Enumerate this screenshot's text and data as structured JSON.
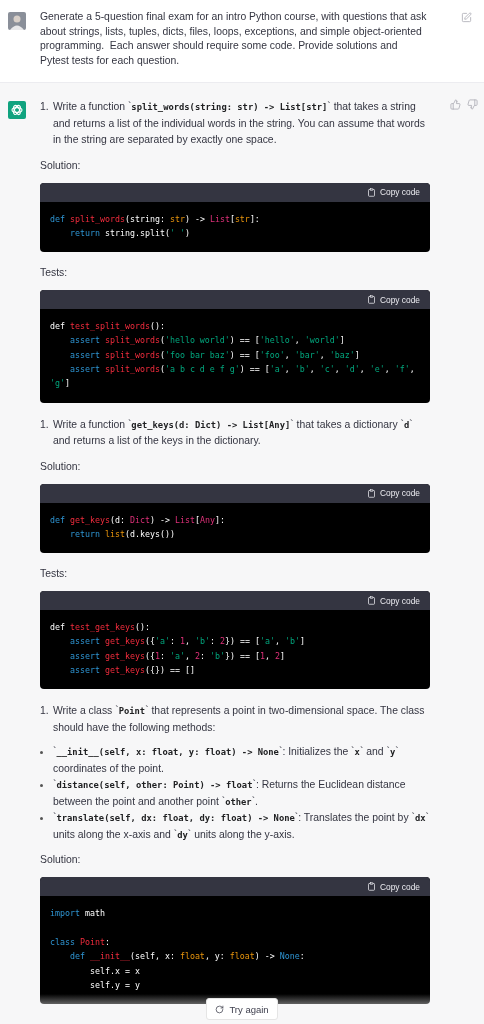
{
  "user_message": {
    "text": "Generate a 5-question final exam for an intro Python course, with questions that ask about strings, lists, tuples, dicts, files, loops, exceptions, and simple object-oriented programming.  Each answer should require some code. Provide solutions and Pytest tests for each question."
  },
  "assistant_message": {
    "blocks": [
      {
        "kind": "item",
        "number": "1.",
        "text": "Write a function `**split_words(string: str) -> List[str]**` that takes a string and returns a list of the individual words in the string. You can assume that words in the string are separated by exactly one space."
      },
      {
        "kind": "label",
        "text": "Solution:"
      },
      {
        "kind": "code",
        "copy_label": "Copy code",
        "groups": [
          [
            [
              {
                "kind": "keyword",
                "text": "def "
              },
              {
                "kind": "function",
                "text": "split_words"
              },
              {
                "kind": "plain",
                "text": "(string: "
              },
              {
                "kind": "builtin",
                "text": "str"
              },
              {
                "kind": "plain",
                "text": ") -> "
              },
              {
                "kind": "type",
                "text": "List"
              },
              {
                "kind": "plain",
                "text": "["
              },
              {
                "kind": "builtin",
                "text": "str"
              },
              {
                "kind": "plain",
                "text": "]:"
              }
            ],
            [
              {
                "kind": "keyword",
                "text": "    return"
              },
              {
                "kind": "plain",
                "text": " string.split("
              },
              {
                "kind": "string",
                "text": "' '"
              },
              {
                "kind": "plain",
                "text": ")"
              }
            ]
          ]
        ]
      },
      {
        "kind": "label",
        "text": "Tests:"
      },
      {
        "kind": "code",
        "copy_label": "Copy code",
        "groups": [
          [
            [
              {
                "kind": "plain",
                "text": "def "
              },
              {
                "kind": "function",
                "text": "test_split_words"
              },
              {
                "kind": "plain",
                "text": "():"
              }
            ],
            [
              {
                "kind": "keyword",
                "text": "    assert "
              },
              {
                "kind": "function",
                "text": "split_words"
              },
              {
                "kind": "plain",
                "text": "("
              },
              {
                "kind": "string",
                "text": "'hello world'"
              },
              {
                "kind": "plain",
                "text": ") == ["
              },
              {
                "kind": "string",
                "text": "'hello'"
              },
              {
                "kind": "plain",
                "text": ", "
              },
              {
                "kind": "string",
                "text": "'world'"
              },
              {
                "kind": "plain",
                "text": "]"
              }
            ],
            [
              {
                "kind": "keyword",
                "text": "    assert "
              },
              {
                "kind": "function",
                "text": "split_words"
              },
              {
                "kind": "plain",
                "text": "("
              },
              {
                "kind": "string",
                "text": "'foo bar baz'"
              },
              {
                "kind": "plain",
                "text": ") == ["
              },
              {
                "kind": "string",
                "text": "'foo'"
              },
              {
                "kind": "plain",
                "text": ", "
              },
              {
                "kind": "string",
                "text": "'bar'"
              },
              {
                "kind": "plain",
                "text": ", "
              },
              {
                "kind": "string",
                "text": "'baz'"
              },
              {
                "kind": "plain",
                "text": "]"
              }
            ],
            [
              {
                "kind": "keyword",
                "text": "    assert "
              },
              {
                "kind": "function",
                "text": "split_words"
              },
              {
                "kind": "plain",
                "text": "("
              },
              {
                "kind": "string",
                "text": "'a b c d e f g'"
              },
              {
                "kind": "plain",
                "text": ") == ["
              },
              {
                "kind": "string",
                "text": "'a'"
              },
              {
                "kind": "plain",
                "text": ", "
              },
              {
                "kind": "string",
                "text": "'b'"
              },
              {
                "kind": "plain",
                "text": ", "
              },
              {
                "kind": "string",
                "text": "'c'"
              },
              {
                "kind": "plain",
                "text": ", "
              },
              {
                "kind": "string",
                "text": "'d'"
              },
              {
                "kind": "plain",
                "text": ", "
              },
              {
                "kind": "string",
                "text": "'e'"
              },
              {
                "kind": "plain",
                "text": ", "
              },
              {
                "kind": "string",
                "text": "'f'"
              },
              {
                "kind": "plain",
                "text": ","
              }
            ],
            [
              {
                "kind": "string",
                "text": "'g'"
              },
              {
                "kind": "plain",
                "text": "]"
              }
            ]
          ]
        ]
      },
      {
        "kind": "item",
        "number": "1.",
        "text": "Write a function `**get_keys(d: Dict) -> List[Any]**` that takes a dictionary `**d**` and returns a list of the keys in the dictionary."
      },
      {
        "kind": "label",
        "text": "Solution:"
      },
      {
        "kind": "code",
        "copy_label": "Copy code",
        "groups": [
          [
            [
              {
                "kind": "keyword",
                "text": "def "
              },
              {
                "kind": "function",
                "text": "get_keys"
              },
              {
                "kind": "plain",
                "text": "(d: "
              },
              {
                "kind": "type",
                "text": "Dict"
              },
              {
                "kind": "plain",
                "text": ") -> "
              },
              {
                "kind": "type",
                "text": "List"
              },
              {
                "kind": "plain",
                "text": "["
              },
              {
                "kind": "type",
                "text": "Any"
              },
              {
                "kind": "plain",
                "text": "]:"
              }
            ],
            [
              {
                "kind": "keyword",
                "text": "    return "
              },
              {
                "kind": "builtin",
                "text": "list"
              },
              {
                "kind": "plain",
                "text": "(d.keys())"
              }
            ]
          ]
        ]
      },
      {
        "kind": "label",
        "text": "Tests:"
      },
      {
        "kind": "code",
        "copy_label": "Copy code",
        "groups": [
          [
            [
              {
                "kind": "plain",
                "text": "def "
              },
              {
                "kind": "function",
                "text": "test_get_keys"
              },
              {
                "kind": "plain",
                "text": "():"
              }
            ],
            [
              {
                "kind": "keyword",
                "text": "    assert "
              },
              {
                "kind": "function",
                "text": "get_keys"
              },
              {
                "kind": "plain",
                "text": "({"
              },
              {
                "kind": "string",
                "text": "'a'"
              },
              {
                "kind": "plain",
                "text": ": "
              },
              {
                "kind": "number",
                "text": "1"
              },
              {
                "kind": "plain",
                "text": ", "
              },
              {
                "kind": "string",
                "text": "'b'"
              },
              {
                "kind": "plain",
                "text": ": "
              },
              {
                "kind": "number",
                "text": "2"
              },
              {
                "kind": "plain",
                "text": "}) == ["
              },
              {
                "kind": "string",
                "text": "'a'"
              },
              {
                "kind": "plain",
                "text": ", "
              },
              {
                "kind": "string",
                "text": "'b'"
              },
              {
                "kind": "plain",
                "text": "]"
              }
            ],
            [
              {
                "kind": "keyword",
                "text": "    assert "
              },
              {
                "kind": "function",
                "text": "get_keys"
              },
              {
                "kind": "plain",
                "text": "({"
              },
              {
                "kind": "number",
                "text": "1"
              },
              {
                "kind": "plain",
                "text": ": "
              },
              {
                "kind": "string",
                "text": "'a'"
              },
              {
                "kind": "plain",
                "text": ", "
              },
              {
                "kind": "number",
                "text": "2"
              },
              {
                "kind": "plain",
                "text": ": "
              },
              {
                "kind": "string",
                "text": "'b'"
              },
              {
                "kind": "plain",
                "text": "}) == ["
              },
              {
                "kind": "number",
                "text": "1"
              },
              {
                "kind": "plain",
                "text": ", "
              },
              {
                "kind": "number",
                "text": "2"
              },
              {
                "kind": "plain",
                "text": "]"
              }
            ],
            [
              {
                "kind": "keyword",
                "text": "    assert "
              },
              {
                "kind": "function",
                "text": "get_keys"
              },
              {
                "kind": "plain",
                "text": "({}) == []"
              }
            ]
          ]
        ]
      },
      {
        "kind": "item",
        "number": "1.",
        "text": "Write a class `**Point**` that represents a point in two-dimensional space. The class should have the following methods:",
        "bullets": [
          "`**__init__(self, x: float, y: float) -> None**`: Initializes the `**x**` and `**y**` coordinates of the point.",
          "`**distance(self, other: Point) -> float**`: Returns the Euclidean distance between the point and another point `**other**`.",
          "`**translate(self, dx: float, dy: float) -> None**`: Translates the point by `**dx**` units along the x-axis and `**dy**` units along the y-axis."
        ]
      },
      {
        "kind": "label",
        "text": "Solution:"
      },
      {
        "kind": "code",
        "copy_label": "Copy code",
        "groups": [
          [
            [
              {
                "kind": "keyword",
                "text": "import"
              },
              {
                "kind": "plain",
                "text": " math"
              }
            ]
          ],
          [
            [
              {
                "kind": "keyword",
                "text": "class "
              },
              {
                "kind": "function",
                "text": "Point"
              },
              {
                "kind": "plain",
                "text": ":"
              }
            ],
            [
              {
                "kind": "keyword",
                "text": "    def "
              },
              {
                "kind": "function",
                "text": "__init__"
              },
              {
                "kind": "plain",
                "text": "(self, x: "
              },
              {
                "kind": "builtin",
                "text": "float"
              },
              {
                "kind": "plain",
                "text": ", y: "
              },
              {
                "kind": "builtin",
                "text": "float"
              },
              {
                "kind": "plain",
                "text": ") -> "
              },
              {
                "kind": "keyword",
                "text": "None"
              },
              {
                "kind": "plain",
                "text": ":"
              }
            ],
            [
              {
                "kind": "plain",
                "text": "        self.x = x"
              }
            ],
            [
              {
                "kind": "plain",
                "text": "        self.y = y"
              }
            ]
          ]
        ]
      }
    ]
  },
  "try_again_button": {
    "label": "Try again"
  }
}
